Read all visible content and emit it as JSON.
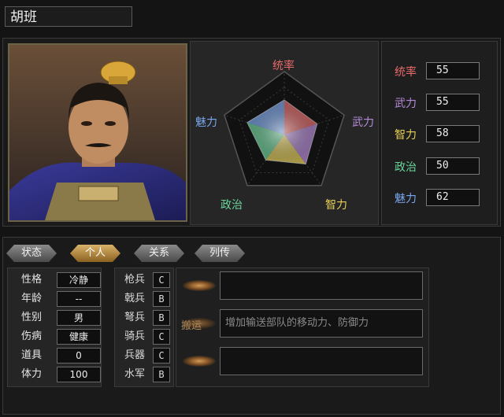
{
  "character": {
    "name": "胡班"
  },
  "radar": {
    "axes": [
      "统率",
      "武力",
      "智力",
      "政治",
      "魅力"
    ],
    "values": [
      55,
      55,
      58,
      50,
      62
    ],
    "max": 100
  },
  "stats": [
    {
      "label": "统率",
      "value": "55",
      "color": "#e86a6a"
    },
    {
      "label": "武力",
      "value": "55",
      "color": "#b58ad8"
    },
    {
      "label": "智力",
      "value": "58",
      "color": "#e6cf5a"
    },
    {
      "label": "政治",
      "value": "50",
      "color": "#6ad49a"
    },
    {
      "label": "魅力",
      "value": "62",
      "color": "#7aa6ee"
    }
  ],
  "tabs": [
    {
      "label": "状态",
      "active": false
    },
    {
      "label": "个人",
      "active": true
    },
    {
      "label": "关系",
      "active": false
    },
    {
      "label": "列传",
      "active": false
    }
  ],
  "personal": [
    {
      "label": "性格",
      "value": "冷静"
    },
    {
      "label": "年龄",
      "value": "--"
    },
    {
      "label": "性别",
      "value": "男"
    },
    {
      "label": "伤病",
      "value": "健康"
    },
    {
      "label": "道具",
      "value": "0"
    },
    {
      "label": "体力",
      "value": "100"
    }
  ],
  "troops": [
    {
      "label": "枪兵",
      "grade": "C"
    },
    {
      "label": "戟兵",
      "grade": "B"
    },
    {
      "label": "弩兵",
      "grade": "B"
    },
    {
      "label": "骑兵",
      "grade": "C"
    },
    {
      "label": "兵器",
      "grade": "C"
    },
    {
      "label": "水军",
      "grade": "B"
    }
  ],
  "skills": [
    {
      "name": "",
      "desc": ""
    },
    {
      "name": "搬运",
      "desc": "增加输送部队的移动力、防御力"
    },
    {
      "name": "",
      "desc": ""
    }
  ]
}
